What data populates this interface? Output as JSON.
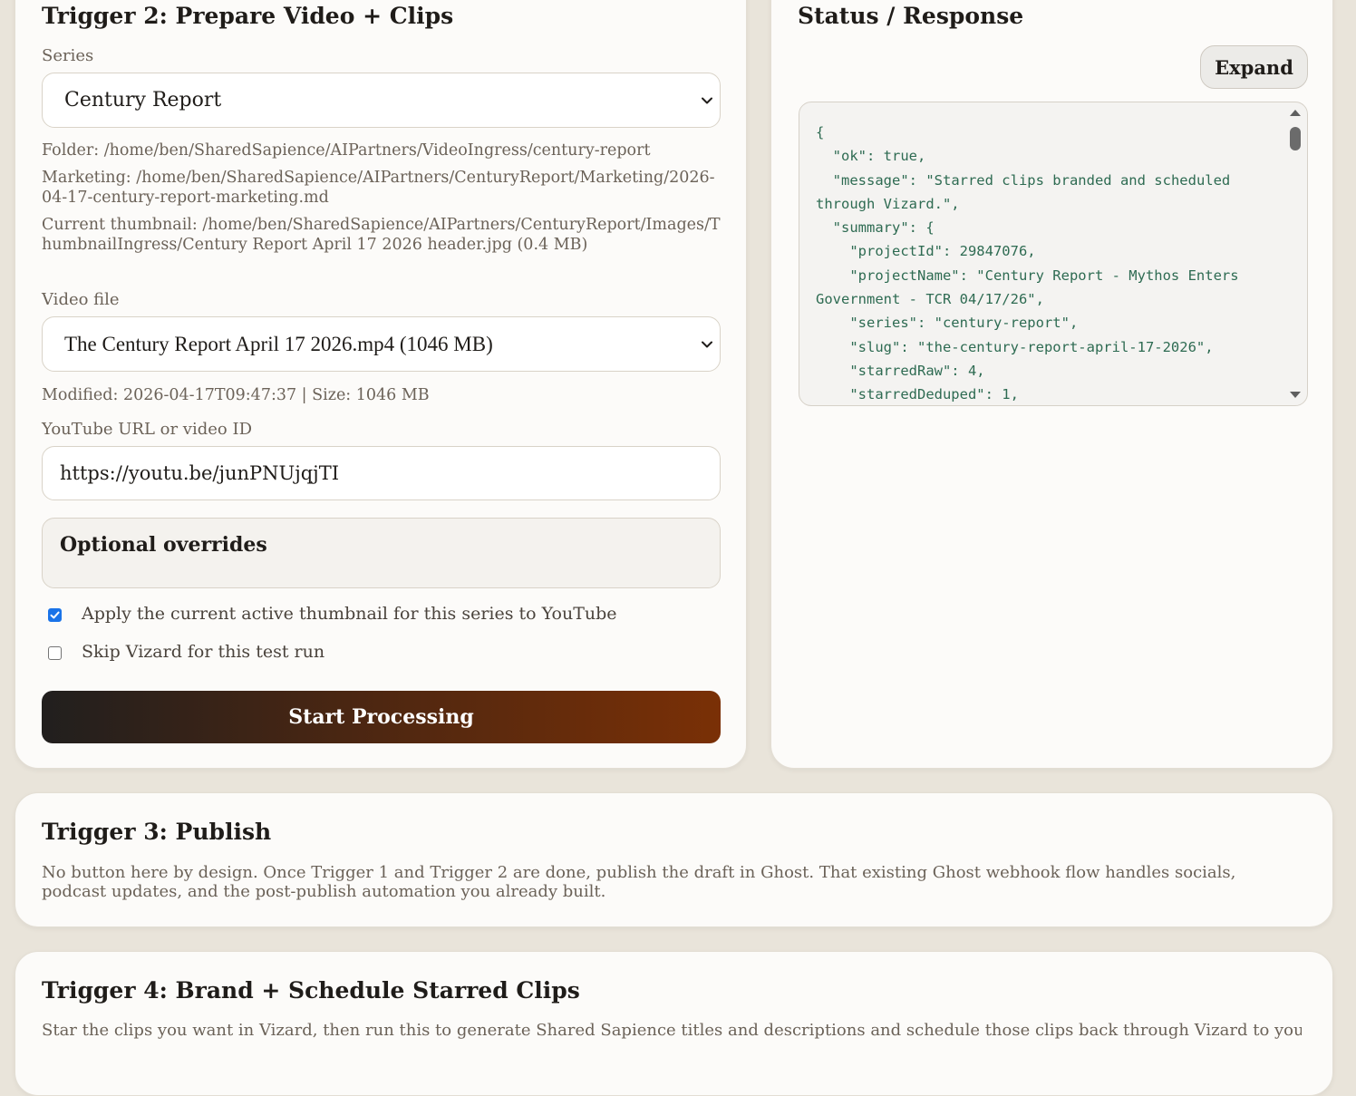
{
  "trigger2": {
    "title": "Trigger 2: Prepare Video + Clips",
    "series_label": "Series",
    "series_value": "Century Report",
    "folder_line": "Folder: /home/ben/SharedSapience/AIPartners/VideoIngress/century-report",
    "marketing_line": "Marketing: /home/ben/SharedSapience/AIPartners/CenturyReport/Marketing/2026-04-17-century-report-marketing.md",
    "thumbnail_line": "Current thumbnail: /home/ben/SharedSapience/AIPartners/CenturyReport/Images/ThumbnailIngress/Century Report April 17 2026 header.jpg (0.4 MB)",
    "video_label": "Video file",
    "video_value": "The Century Report April 17 2026.mp4 (1046 MB)",
    "modified_line": "Modified: 2026-04-17T09:47:37 | Size: 1046 MB",
    "youtube_label": "YouTube URL or video ID",
    "youtube_value": "https://youtu.be/junPNUjqjTI",
    "overrides_title": "Optional overrides",
    "apply_thumbnail_label": "Apply the current active thumbnail for this series to YouTube",
    "apply_thumbnail_checked": true,
    "skip_vizard_label": "Skip Vizard for this test run",
    "skip_vizard_checked": false,
    "start_button": "Start Processing"
  },
  "status": {
    "title": "Status / Response",
    "expand_button": "Expand",
    "response_text": "{\n  \"ok\": true,\n  \"message\": \"Starred clips branded and scheduled through Vizard.\",\n  \"summary\": {\n    \"projectId\": 29847076,\n    \"projectName\": \"Century Report - Mythos Enters Government - TCR 04/17/26\",\n    \"series\": \"century-report\",\n    \"slug\": \"the-century-report-april-17-2026\",\n    \"starredRaw\": 4,\n    \"starredDeduped\": 1,"
  },
  "trigger3": {
    "title": "Trigger 3: Publish",
    "description": "No button here by design. Once Trigger 1 and Trigger 2 are done, publish the draft in Ghost. That existing Ghost webhook flow handles socials, podcast updates, and the post-publish automation you already built."
  },
  "trigger4": {
    "title": "Trigger 4: Brand + Schedule Starred Clips",
    "description": "Star the clips you want in Vizard, then run this to generate Shared Sapience titles and descriptions and schedule those clips back through Vizard to your connected"
  },
  "colors": {
    "page_background": "#e9e4da",
    "card_background": "#fcfbf9",
    "button_gradient_start": "#211f1e",
    "button_gradient_end": "#7a3006",
    "checkbox_checked": "#1a73e8",
    "code_text": "#2e6b52"
  },
  "icons": {
    "select_chevron": "chevron-down-icon",
    "checkbox_checked": "checkmark-icon",
    "scroll_up": "triangle-up-icon",
    "scroll_down": "triangle-down-icon"
  }
}
